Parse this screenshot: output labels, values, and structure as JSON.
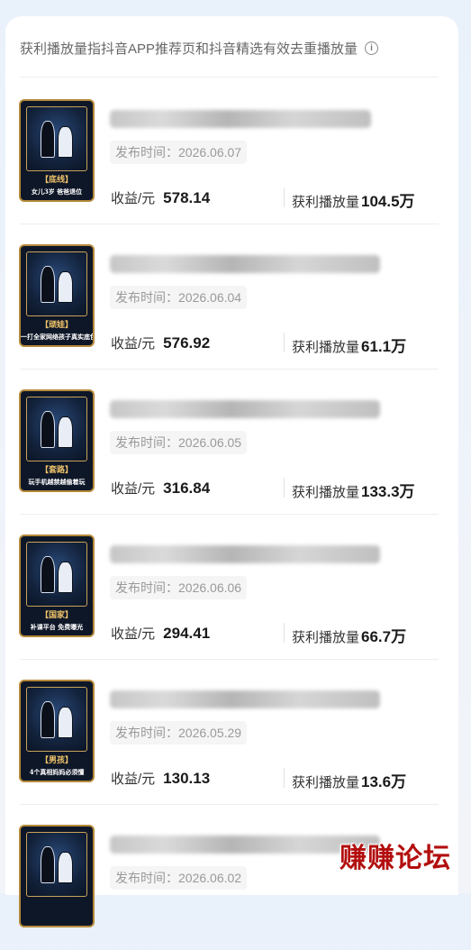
{
  "header": {
    "text": "获利播放量指抖音APP推荐页和抖音精选有效去重播放量",
    "info_icon": "info-circle-icon"
  },
  "labels": {
    "publish_prefix": "发布时间：",
    "income": "收益/元",
    "plays": "获利播放量"
  },
  "items": [
    {
      "tag": "【底线】",
      "subtitle": "女儿3岁 爸爸退位",
      "date": "2026.06.07",
      "income": "578.14",
      "plays": "104.5万"
    },
    {
      "tag": "【顽娃】",
      "subtitle": "一打全家网络孩子真实底色",
      "date": "2026.06.04",
      "income": "576.92",
      "plays": "61.1万"
    },
    {
      "tag": "【套路】",
      "subtitle": "玩手机越禁越偷着玩",
      "date": "2026.06.05",
      "income": "316.84",
      "plays": "133.3万"
    },
    {
      "tag": "【国家】",
      "subtitle": "补课平台 免费曝光",
      "date": "2026.06.06",
      "income": "294.41",
      "plays": "66.7万"
    },
    {
      "tag": "【男孩】",
      "subtitle": "4个真相妈妈必须懂",
      "date": "2026.05.29",
      "income": "130.13",
      "plays": "13.6万"
    },
    {
      "tag": "",
      "subtitle": "",
      "date": "2026.06.02",
      "income": "",
      "plays": ""
    }
  ],
  "watermark": "赚赚论坛"
}
